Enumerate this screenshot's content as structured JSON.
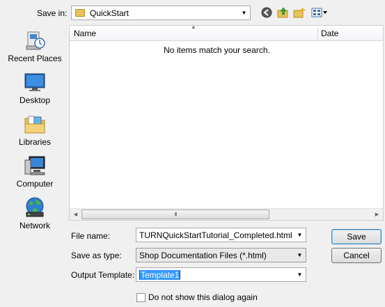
{
  "toolbar": {
    "save_in_label": "Save in:",
    "current_folder": "QuickStart",
    "icons": [
      "back-icon",
      "up-folder-icon",
      "new-folder-icon",
      "view-menu-icon"
    ]
  },
  "places": [
    {
      "label": "Recent Places",
      "icon": "recent-places-icon"
    },
    {
      "label": "Desktop",
      "icon": "desktop-icon"
    },
    {
      "label": "Libraries",
      "icon": "libraries-icon"
    },
    {
      "label": "Computer",
      "icon": "computer-icon"
    },
    {
      "label": "Network",
      "icon": "network-icon"
    }
  ],
  "filelist": {
    "columns": [
      "Name",
      "Date"
    ],
    "empty_message": "No items match your search.",
    "scroll_grip": "III"
  },
  "form": {
    "file_name_label": "File name:",
    "file_name_value": "TURNQuickStartTutorial_Completed.html",
    "save_type_label": "Save as type:",
    "save_type_value": "Shop Documentation Files (*.html)",
    "template_label": "Output Template:",
    "template_value": "Template1",
    "dont_show_label": "Do not show this dialog again"
  },
  "buttons": {
    "save": "Save",
    "cancel": "Cancel"
  },
  "colors": {
    "selection": "#3399ff",
    "window_bg": "#f0f0f0",
    "folder": "#e8c25a"
  }
}
